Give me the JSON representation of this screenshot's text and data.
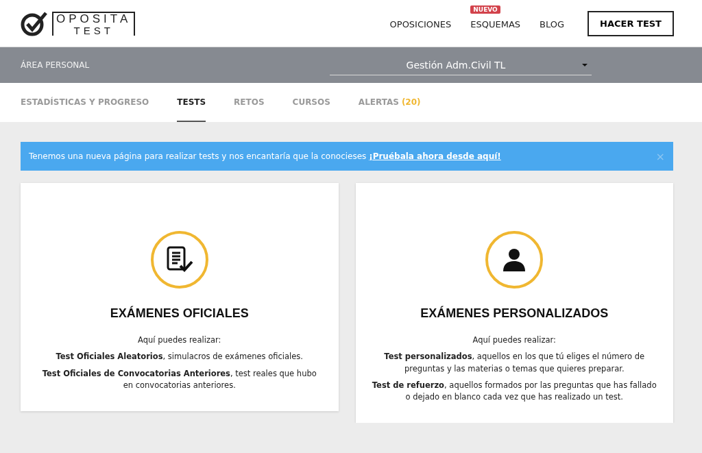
{
  "logo": {
    "top": "OPOSITA",
    "bottom": "TEST"
  },
  "nav": [
    {
      "label": "OPOSICIONES"
    },
    {
      "label": "ESQUEMAS",
      "badge": "NUEVO"
    },
    {
      "label": "BLOG"
    }
  ],
  "cta_button": "HACER TEST",
  "personal_bar": {
    "title": "ÁREA PERSONAL",
    "select_value": "Gestión Adm.Civil TL"
  },
  "tabs": [
    {
      "label": "ESTADÍSTICAS Y PROGRESO",
      "selected": false
    },
    {
      "label": "TESTS",
      "selected": true
    },
    {
      "label": "RETOS",
      "selected": false
    },
    {
      "label": "CURSOS",
      "selected": false
    },
    {
      "label": "ALERTAS",
      "count": "(20)",
      "selected": false
    }
  ],
  "alert": {
    "text": "Tenemos una nueva página para realizar tests y nos encantaría que la conocieses",
    "link": "¡Pruébala ahora desde aquí!",
    "close": "×"
  },
  "cards": [
    {
      "kind": "document",
      "title": "EXÁMENES OFICIALES",
      "intro": "Aquí puedes realizar:",
      "paragraphs": [
        "**Test Oficiales Aleatorios**, simulacros de exámenes oficiales.",
        "**Test Oficiales de Convocatorias Anteriores**, test reales que hubo en convocatorias anteriores."
      ]
    },
    {
      "kind": "person",
      "title": "EXÁMENES PERSONALIZADOS",
      "intro": "Aquí puedes realizar:",
      "paragraphs": [
        "**Test personalizados**, aquellos en los que tú eliges el número de preguntas y las materias o temas que quieres preparar.",
        "**Test de refuerzo**, aquellos formados por las preguntas que has fallado o dejado en blanco cada vez que has realizado un test."
      ]
    }
  ]
}
